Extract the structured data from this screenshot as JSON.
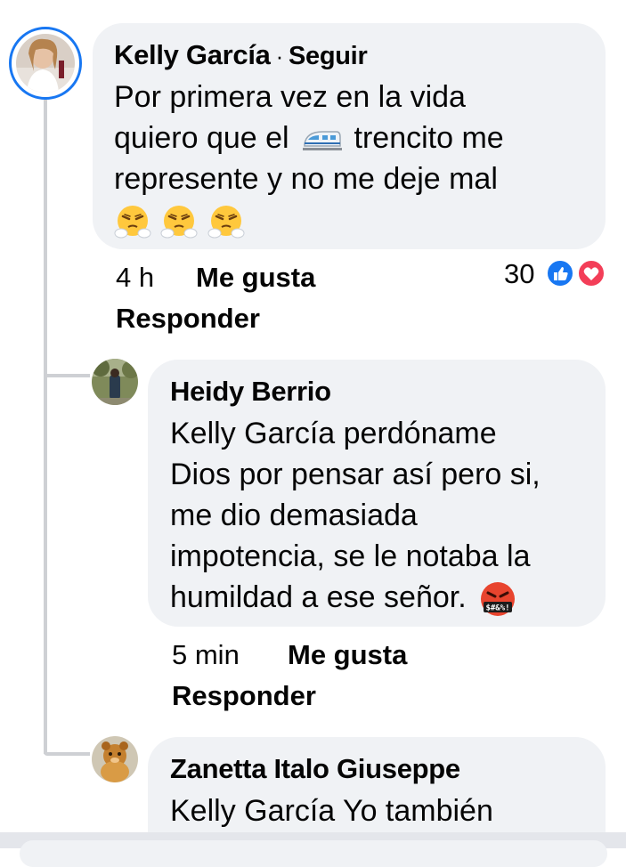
{
  "comments": [
    {
      "author": "Kelly García",
      "follow_label": "Seguir",
      "text_lines": [
        "Por primera vez en la vida",
        "quiero que el",
        "trencito me",
        "represente y no me deje mal"
      ],
      "emojis": [
        "steam-from-nose",
        "steam-from-nose",
        "steam-from-nose"
      ],
      "train_emoji": "train",
      "time": "4 h",
      "like_label": "Me gusta",
      "reply_label": "Responder",
      "reaction_count": "30"
    },
    {
      "author": "Heidy Berrio",
      "text_lines": [
        "Kelly García perdóname",
        "Dios por pensar así pero si,",
        "me dio demasiada",
        "impotencia, se le notaba la",
        "humildad a ese señor."
      ],
      "emoji": "cursing-face",
      "time": "5 min",
      "like_label": "Me gusta",
      "reply_label": "Responder"
    },
    {
      "author": "Zanetta Italo Giuseppe",
      "text_lines": [
        "Kelly García Yo también"
      ]
    }
  ],
  "colors": {
    "bubble": "#f0f2f5",
    "thread_line": "#ced0d4",
    "avatar_ring": "#1877f2",
    "like_blue": "#1877f2",
    "love_red": "#f33e58"
  }
}
